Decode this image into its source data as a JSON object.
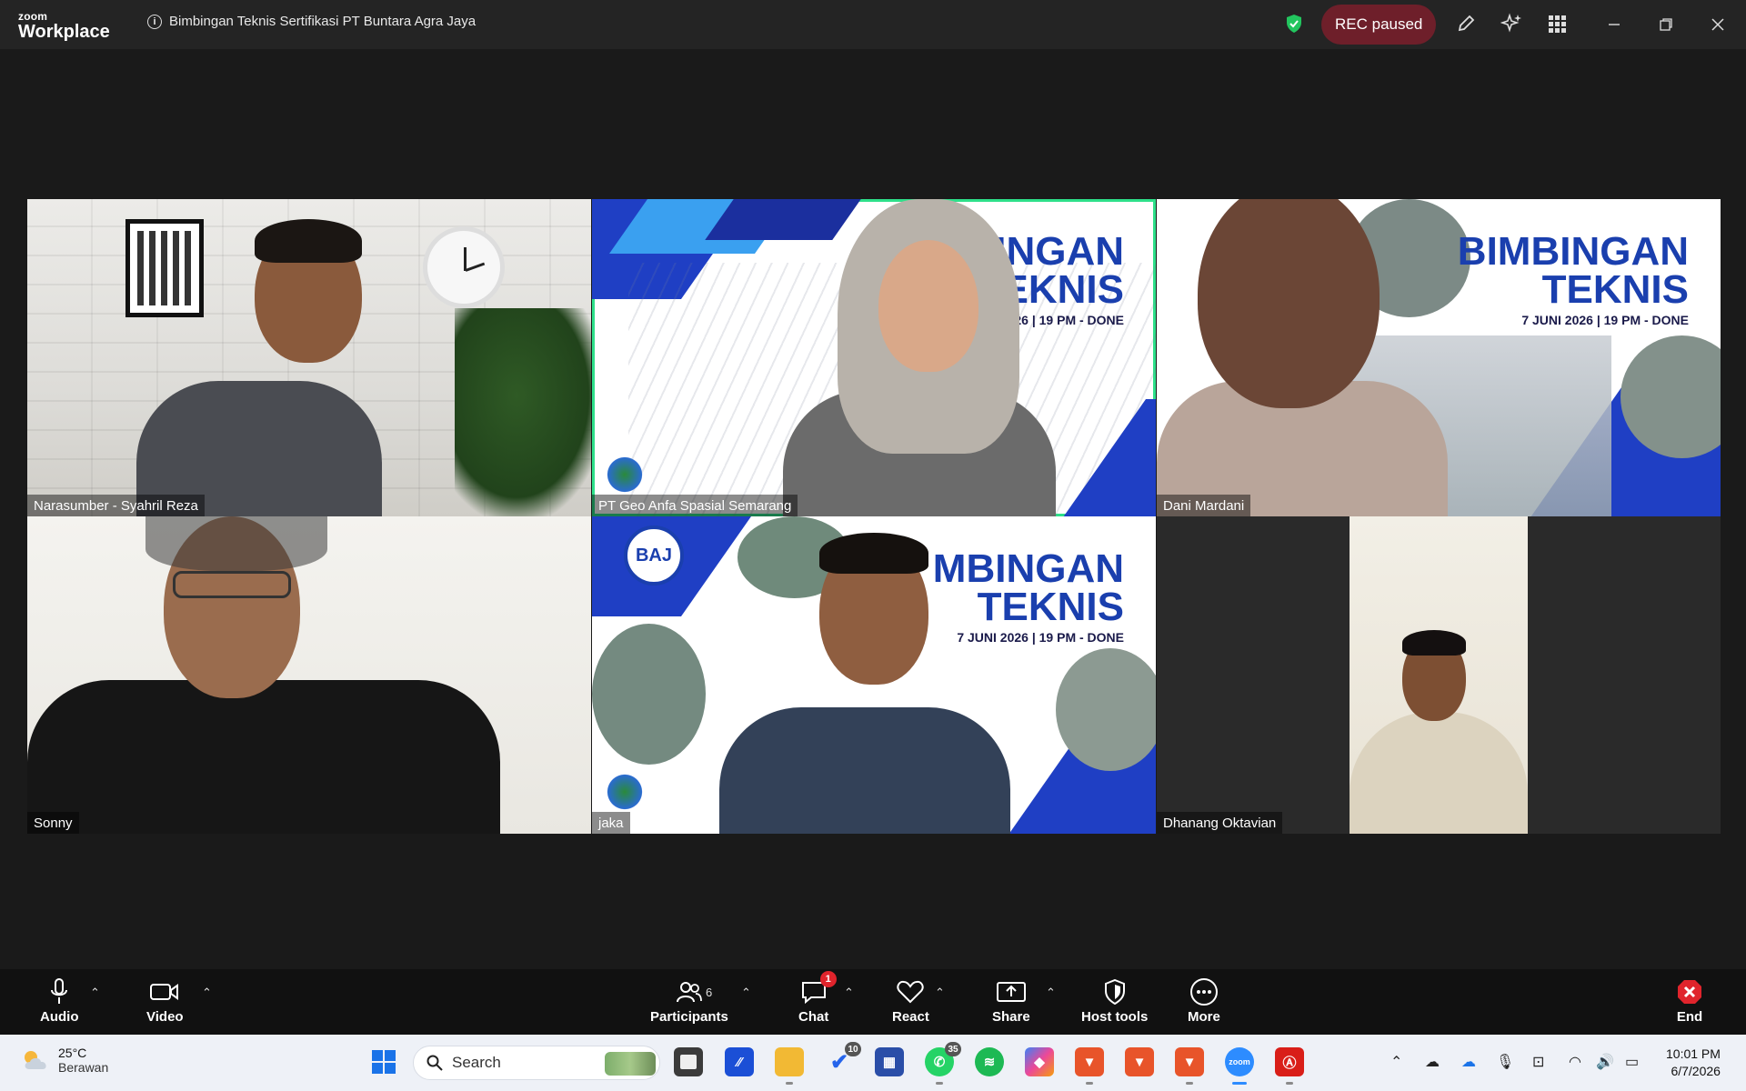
{
  "app": {
    "brand_small": "zoom",
    "brand_large": "Workplace",
    "meeting_title": "Bimbingan Teknis Sertifikasi PT Buntara Agra Jaya",
    "rec_status": "REC paused",
    "accent_color": "#2ee08a",
    "rec_color": "#6e1f2a"
  },
  "participants": [
    {
      "name": "Narasumber - Syahril Reza"
    },
    {
      "name": "PT Geo Anfa Spasial Semarang"
    },
    {
      "name": "Dani Mardani"
    },
    {
      "name": "Sonny"
    },
    {
      "name": "jaka"
    },
    {
      "name": "Dhanang Oktavian"
    }
  ],
  "banner": {
    "title_line1": "BIMBINGAN",
    "title_line2": "TEKNIS",
    "title_line1_cropped": "INGAN",
    "title_line1_cropped_b": "MBINGAN",
    "date": "7 JUNI 2026 | 19 PM - DONE",
    "date_cropped": "2026 | 19 PM - DONE",
    "logo_text": "BAJ"
  },
  "controls": {
    "audio": "Audio",
    "video": "Video",
    "participants": "Participants",
    "participants_count": "6",
    "chat": "Chat",
    "chat_badge": "1",
    "react": "React",
    "share": "Share",
    "host_tools": "Host tools",
    "more": "More",
    "end": "End"
  },
  "taskbar": {
    "temperature": "25°C",
    "weather": "Berawan",
    "search_placeholder": "Search",
    "todo_badge": "10",
    "whatsapp_badge": "35",
    "time": "10:01 PM",
    "date": "6/7/2026"
  }
}
